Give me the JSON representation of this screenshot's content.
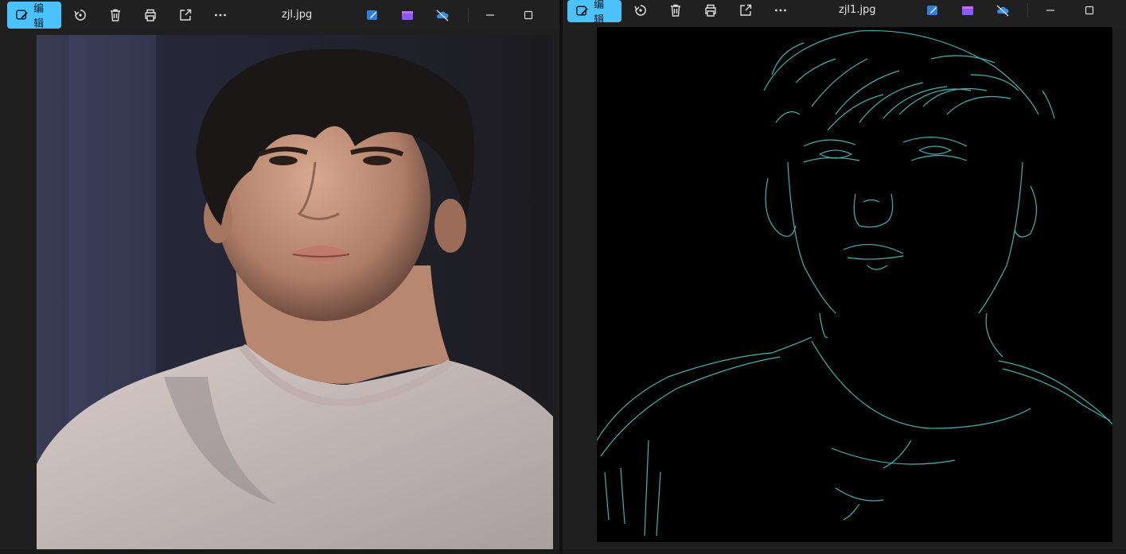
{
  "left_window": {
    "edit_label": "编辑",
    "file_name": "zjl.jpg",
    "toolbar": [
      "rotate-icon",
      "delete-icon",
      "print-icon",
      "share-icon",
      "more-icon"
    ],
    "app_icons": [
      "edit-app-icon",
      "clipchamp-icon",
      "onedrive-icon"
    ],
    "controls": [
      "minimize-icon",
      "maximize-icon"
    ]
  },
  "right_window": {
    "edit_label": "编辑",
    "file_name": "zjl1.jpg",
    "toolbar": [
      "rotate-icon",
      "delete-icon",
      "print-icon",
      "share-icon",
      "more-icon"
    ],
    "app_icons": [
      "edit-app-icon",
      "clipchamp-icon",
      "onedrive-icon"
    ],
    "controls": [
      "minimize-icon",
      "maximize-icon"
    ]
  },
  "colors": {
    "accent": "#4cc2ff",
    "edge_lines": "#3fb3b0",
    "titlebar": "#202020"
  }
}
